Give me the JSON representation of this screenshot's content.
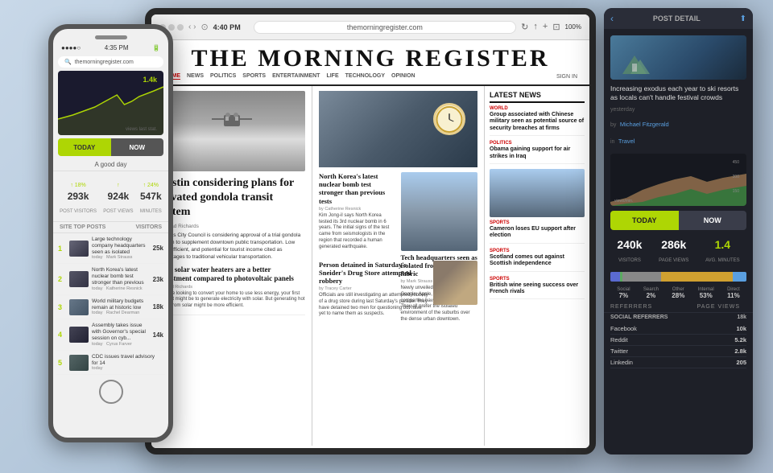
{
  "phone": {
    "status_time": "4:35 PM",
    "url": "themorningregister.com",
    "chart_value": "1.4k",
    "chart_sublabel": "views last stat.",
    "today_label": "TODAY",
    "now_label": "NOW",
    "good_day": "A good day",
    "stats": [
      {
        "arrow": "↑ 18%",
        "value": "293k",
        "label": "POST VISITORS"
      },
      {
        "arrow": "↑",
        "value": "924k",
        "label": "POST VIEWS"
      },
      {
        "arrow": "↑ 24%",
        "value": "547k",
        "label": "MINUTES"
      }
    ],
    "site_label": "SITE TOP POSTS",
    "visitors_label": "VISITORS",
    "posts": [
      {
        "num": "1",
        "title": "Large technology company headquarters seen as isolated",
        "date": "today",
        "author": "Mark Strauss",
        "count": "25k"
      },
      {
        "num": "2",
        "title": "North Korea's latest nuclear bomb test stronger than previous",
        "date": "today",
        "author": "Katherine Resnick",
        "count": "23k"
      },
      {
        "num": "3",
        "title": "World military budgets remain at historic low",
        "date": "today",
        "author": "Rachel Dearman",
        "count": "18k"
      },
      {
        "num": "4",
        "title": "Assembly takes issue with Governor's special session on cyb...",
        "date": "today",
        "author": "Cyrus Farver",
        "count": "14k"
      },
      {
        "num": "5",
        "title": "CDC issues travel advisory for 14",
        "date": "today",
        "author": "",
        "count": ""
      }
    ]
  },
  "tablet": {
    "time": "4:40 PM",
    "url": "themorningregister.com",
    "battery": "100%",
    "newspaper_title": "THE MORNING REGISTER",
    "nav_links": [
      "HOME",
      "NEWS",
      "POLITICS",
      "SPORTS",
      "ENTERTAINMENT",
      "LIFE",
      "TECHNOLOGY",
      "OPINION"
    ],
    "active_nav": "HOME",
    "sign_in": "SIGN IN",
    "main_article": {
      "headline": "Austin considering plans for elevated gondola transit system",
      "byline": "by Thad Richards",
      "body": "Austin's City Council is considering approval of a trial gondola system to supplement downtown public transportation. Low cost, efficient, and potential for tourist income cited as advantages to traditional vehicular transportation."
    },
    "sub_articles": [
      {
        "headline": "Why solar water heaters are a better investment compared to photovoltaic panels",
        "byline": "by Thad Richards",
        "body": "If you're looking to convert your home to use less energy, your first thought might be to generate electricity with solar. But generating hot water from solar might be more efficient."
      }
    ],
    "center_articles": [
      {
        "headline": "North Korea's latest nuclear bomb test stronger than previous tests",
        "byline": "by Catherine Resnick",
        "body": "Kim Jong-il says North Korea tested its 3rd nuclear bomb in 6 years. The initial signs of the test came from seismologists in the region that recorded a human generated earthquake."
      },
      {
        "headline": "Tech headquarters seen as isolated from urban fabric",
        "byline": "by Mark Strauss",
        "body": "Newly unveiled headquarters for Google, Apple, and other tech companies have a lot in common. They all prefer the isolated environment of the suburbs over the dense urban downtown."
      },
      {
        "headline": "Person detained in Saturday's Sneider's Drug Store attempted robbery",
        "byline": "by Tracey Carter",
        "body": "Officials are still investigating an attempted robbery of a drug store during last Saturday's parade. They have detained two men for questioning but have yet to name them as suspects."
      }
    ],
    "latest_news": {
      "title": "Latest News",
      "items": [
        {
          "category": "WORLD",
          "headline": "Group associated with Chinese military seen as potential source of security breaches at firms",
          "time": ""
        },
        {
          "category": "POLITICS",
          "headline": "Obama gaining support for air strikes in Iraq",
          "time": ""
        },
        {
          "category": "SPORTS",
          "headline": "Cameron loses EU support after election",
          "time": ""
        },
        {
          "category": "SPORTS",
          "headline": "Scotland comes out against Scottish independence",
          "time": ""
        },
        {
          "category": "SPORTS",
          "headline": "British wine seeing success over French rivals",
          "time": ""
        }
      ]
    }
  },
  "analytics": {
    "back_label": "‹",
    "section_label": "POST DETAIL",
    "external_icon": "⬆",
    "post_headline": "Increasing exodus each year to ski resorts as locals can't handle festival crowds",
    "date_label": "yesterday",
    "author_label": "by",
    "author_name": "Michael Fitzgerald",
    "in_label": "in",
    "category": "Travel",
    "today_label": "TODAY",
    "now_label": "NOW",
    "stats": [
      {
        "value": "240k",
        "label": "VISITORS",
        "green": false
      },
      {
        "value": "286k",
        "label": "PAGE VIEWS",
        "green": false
      },
      {
        "value": "1.4",
        "label": "AVG. MINUTES",
        "green": true
      }
    ],
    "chart_axis_labels": [
      "450",
      "300",
      "150"
    ],
    "chart_label": "views/min.",
    "traffic_segments": [
      {
        "label": "Social",
        "pct": "7%",
        "width": 7,
        "color": "#5a6ad0"
      },
      {
        "label": "Search",
        "pct": "2%",
        "width": 2,
        "color": "#5aaa60"
      },
      {
        "label": "Other",
        "pct": "28%",
        "width": 28,
        "color": "#888"
      },
      {
        "label": "Internal",
        "pct": "53%",
        "width": 53,
        "color": "#d0a030"
      },
      {
        "label": "Direct",
        "pct": "11%",
        "width": 11,
        "color": "#5a9fe0"
      }
    ],
    "referrers_label": "REFERRERS",
    "page_views_label": "PAGE VIEWS",
    "social_referrers_label": "SOCIAL REFERRERS",
    "social_referrers_total": "18k",
    "social_rows": [
      {
        "name": "Facebook",
        "value": "10k"
      },
      {
        "name": "Reddit",
        "value": "5.2k"
      },
      {
        "name": "Twitter",
        "value": "2.8k"
      },
      {
        "name": "Linkedin",
        "value": "205"
      }
    ]
  }
}
